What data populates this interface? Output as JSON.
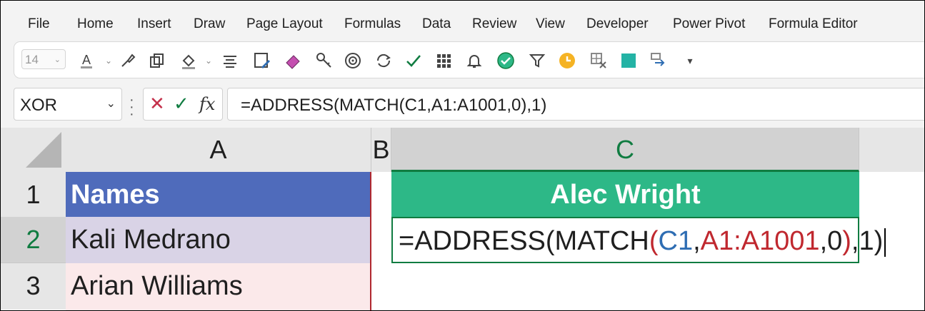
{
  "menu": {
    "items": [
      "File",
      "Home",
      "Insert",
      "Draw",
      "Page Layout",
      "Formulas",
      "Data",
      "Review",
      "View",
      "Developer",
      "Power Pivot",
      "Formula Editor"
    ]
  },
  "toolbar": {
    "font_size": "14",
    "icons": [
      "font-color-icon",
      "format-painter-icon",
      "copy-icon",
      "fill-color-icon",
      "align-icon",
      "save-edit-icon",
      "eraser-icon",
      "key-icon",
      "target-icon",
      "refresh-icon",
      "checkmark-icon",
      "grid-icon",
      "bell-icon",
      "check-circle-icon",
      "filter-icon",
      "clock-icon",
      "clear-table-icon",
      "teal-square-icon",
      "swap-icon",
      "more-icon"
    ]
  },
  "formula_bar": {
    "name_box": "XOR",
    "formula": "=ADDRESS(MATCH(C1,A1:A1001,0),1)"
  },
  "columns": [
    "A",
    "B",
    "C"
  ],
  "rows": [
    "1",
    "2",
    "3"
  ],
  "cells": {
    "A1": "Names",
    "A2": "Kali Medrano",
    "A3": "Arian Williams",
    "C1": "Alec Wright"
  },
  "cell_c2_formula": {
    "prefix": "=ADDRESS(MATCH",
    "open": "(",
    "ref1": "C1",
    "comma1": ",",
    "ref2": "A1:A1001",
    "rest1": ",0",
    "close": ")",
    "suffix": ",1)"
  },
  "colors": {
    "header_blue": "#4f6bbb",
    "header_green": "#2db887",
    "row2_fill": "#d9d3e6",
    "row3_fill": "#fbe9ea",
    "excel_green": "#107c41"
  }
}
